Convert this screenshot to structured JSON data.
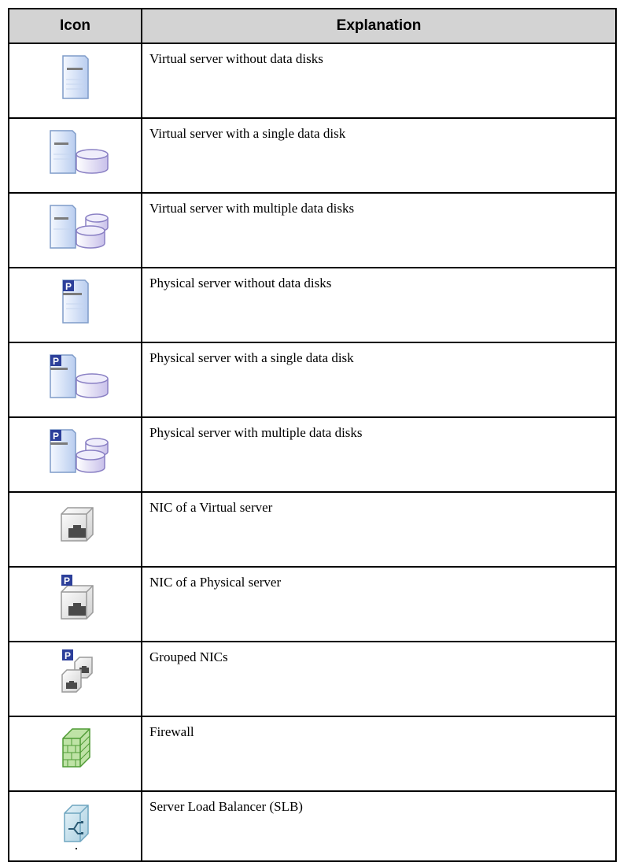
{
  "table": {
    "headers": {
      "icon": "Icon",
      "explanation": "Explanation"
    },
    "rows": [
      {
        "icon": "virtual-server-icon",
        "explanation": "Virtual server without data disks"
      },
      {
        "icon": "virtual-server-single-disk-icon",
        "explanation": "Virtual server with a single data disk"
      },
      {
        "icon": "virtual-server-multiple-disks-icon",
        "explanation": "Virtual server with multiple data disks"
      },
      {
        "icon": "physical-server-icon",
        "explanation": "Physical server without data disks"
      },
      {
        "icon": "physical-server-single-disk-icon",
        "explanation": "Physical server with a single data disk"
      },
      {
        "icon": "physical-server-multiple-disks-icon",
        "explanation": "Physical server with multiple data disks"
      },
      {
        "icon": "virtual-nic-icon",
        "explanation": "NIC of a Virtual server"
      },
      {
        "icon": "physical-nic-icon",
        "explanation": "NIC of a Physical server"
      },
      {
        "icon": "grouped-nics-icon",
        "explanation": "Grouped NICs"
      },
      {
        "icon": "firewall-icon",
        "explanation": "Firewall"
      },
      {
        "icon": "server-load-balancer-icon",
        "explanation": "Server Load Balancer (SLB)"
      }
    ]
  }
}
